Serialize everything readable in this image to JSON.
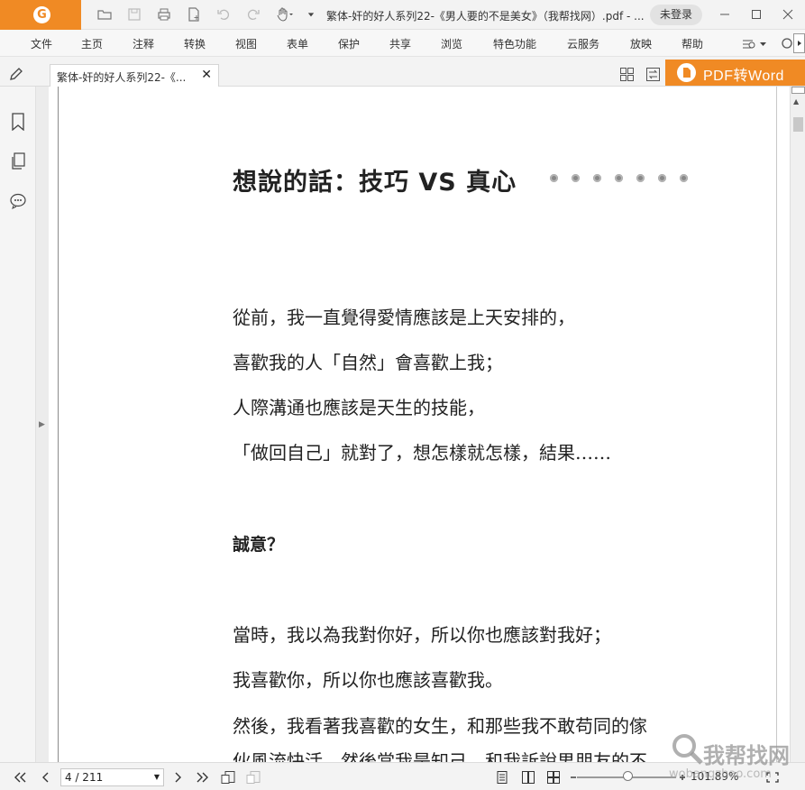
{
  "app": {
    "title": "繁体-奸的好人系列22-《男人要的不是美女》（我帮找网）.pdf - ...",
    "login_label": "未登录",
    "logo_glyph": "G"
  },
  "menu": [
    "文件",
    "主页",
    "注释",
    "转换",
    "视图",
    "表单",
    "保护",
    "共享",
    "浏览",
    "特色功能",
    "云服务",
    "放映",
    "帮助"
  ],
  "tab": {
    "label": "繁体-奸的好人系列22-《...",
    "close": "✕"
  },
  "promo": {
    "label": "PDF转Word"
  },
  "document": {
    "title": "想說的話：技巧 VS 真心",
    "lines": [
      "從前，我一直覺得愛情應該是上天安排的，",
      "喜歡我的人「自然」會喜歡上我；",
      "人際溝通也應該是天生的技能，",
      "「做回自己」就對了，想怎樣就怎樣，結果……",
      "誠意？",
      "當時，我以為我對你好，所以你也應該對我好；",
      "我喜歡你，所以你也應該喜歡我。",
      "然後，我看著我喜歡的女生，和那些我不敢苟同的傢",
      "伙風流快活，然後當我是知己，和我訴說男朋友的不"
    ]
  },
  "status": {
    "page_value": "4 / 211",
    "zoom": "101.89%"
  },
  "watermark": {
    "text": "我帮找网",
    "sub": "wobangzhao.com"
  },
  "colors": {
    "accent": "#f08a24",
    "title_bg": "#f3f3f3"
  }
}
